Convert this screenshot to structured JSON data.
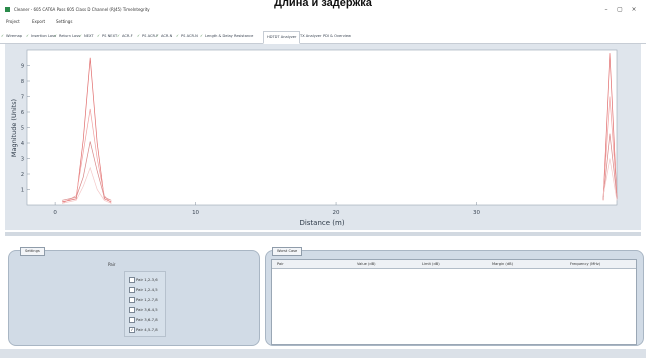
{
  "caption": "Длина и задержка",
  "window": {
    "title": "Cleaner - 605 CAT6A Pass 605 Class D Channel (RJ45) TimeIntegrity",
    "minimize_glyph": "–",
    "maximize_glyph": "▢",
    "close_glyph": "×"
  },
  "menu": [
    "Project",
    "Export",
    "Settings"
  ],
  "tabs": [
    {
      "label": "Wiremap",
      "check": true
    },
    {
      "label": "Insertion Loss",
      "check": true
    },
    {
      "label": "Return Loss",
      "check": true
    },
    {
      "label": "NEXT",
      "check": true
    },
    {
      "label": "PS NEXT",
      "check": true
    },
    {
      "label": "ACR-F",
      "check": true
    },
    {
      "label": "PS ACR-F",
      "check": true
    },
    {
      "label": "ACR-N",
      "check": true
    },
    {
      "label": "PS ACR-N",
      "check": true
    },
    {
      "label": "Length & Delay",
      "check": true
    },
    {
      "label": "Resistance",
      "check": false
    },
    {
      "label": "HDTDT Analyzer",
      "check": false,
      "active": true
    },
    {
      "label": "TX Analyzer",
      "check": false
    },
    {
      "label": "PDI & Overview",
      "check": false
    }
  ],
  "chart_data": {
    "type": "line",
    "xlabel": "Distance (m)",
    "ylabel": "Magnitude (Units)",
    "xlim": [
      -2,
      40
    ],
    "ylim": [
      0,
      10
    ],
    "x_ticks": [
      "0",
      "10",
      "20",
      "30"
    ],
    "y_ticks": [
      "1",
      "2",
      "3",
      "4",
      "5",
      "6",
      "7",
      "8",
      "9"
    ],
    "series": [
      {
        "color": "#e06a6a",
        "x": [
          0.5,
          1.5,
          2.0,
          2.5,
          3.0,
          3.5,
          4.0,
          39.0,
          39.5,
          40.0
        ],
        "values": [
          0.2,
          0.4,
          4.2,
          9.5,
          4.0,
          0.4,
          0.2,
          0.3,
          9.8,
          0.4
        ]
      },
      {
        "color": "#f0a0a0",
        "x": [
          0.5,
          1.5,
          2.0,
          2.5,
          3.0,
          3.5,
          4.0,
          39.0,
          39.5,
          40.0
        ],
        "values": [
          0.1,
          0.6,
          3.4,
          6.2,
          3.0,
          0.6,
          0.1,
          0.5,
          7.0,
          0.6
        ]
      },
      {
        "color": "#d88888",
        "x": [
          0.5,
          1.5,
          2.0,
          2.5,
          3.0,
          3.5,
          4.0,
          39.0,
          39.5,
          40.0
        ],
        "values": [
          0.3,
          0.5,
          1.8,
          4.1,
          2.2,
          0.5,
          0.3,
          0.4,
          4.6,
          0.5
        ]
      },
      {
        "color": "#f4c8c8",
        "x": [
          0.5,
          1.5,
          2.0,
          2.5,
          3.0,
          3.5,
          4.0,
          39.0,
          39.5,
          40.0
        ],
        "values": [
          0.1,
          0.3,
          1.2,
          2.4,
          1.0,
          0.3,
          0.1,
          0.6,
          3.0,
          0.3
        ]
      }
    ],
    "grid": false,
    "legend": "none"
  },
  "settings_panel": {
    "tab_label": "Settings",
    "pair_label": "Pair",
    "pairs": [
      {
        "label": "Pair 1,2-3,6",
        "checked": false
      },
      {
        "label": "Pair 1,2-4,5",
        "checked": false
      },
      {
        "label": "Pair 1,2-7,8",
        "checked": false
      },
      {
        "label": "Pair 3,6-4,5",
        "checked": false
      },
      {
        "label": "Pair 3,6-7,8",
        "checked": false
      },
      {
        "label": "Pair 4,5-7,8",
        "checked": true
      }
    ]
  },
  "results_panel": {
    "tab_label": "Worst Case",
    "columns": [
      "Pair",
      "Value (dB)",
      "Limit (dB)",
      "Margin (dB)",
      "Frequency (MHz)"
    ]
  }
}
